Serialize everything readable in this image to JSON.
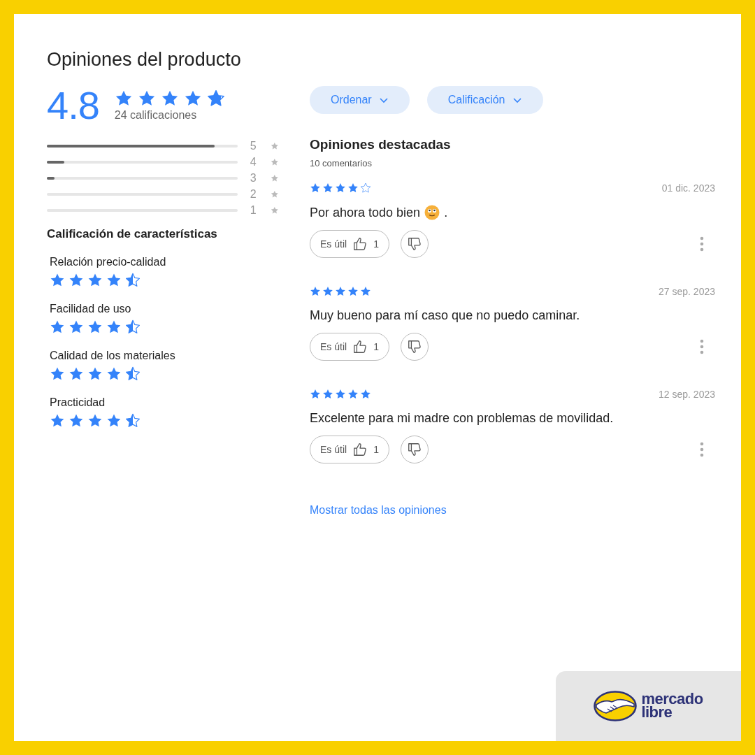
{
  "title": "Opiniones del producto",
  "summary": {
    "average": "4.8",
    "stars": 4.8,
    "count": "24 calificaciones"
  },
  "distribution": [
    {
      "label": "5",
      "level": 0.88
    },
    {
      "label": "4",
      "level": 0.09
    },
    {
      "label": "3",
      "level": 0.04
    },
    {
      "label": "2",
      "level": 0
    },
    {
      "label": "1",
      "level": 0
    }
  ],
  "features": {
    "heading": "Calificación de características",
    "items": [
      {
        "name": "Relación precio-calidad",
        "stars": 4.5
      },
      {
        "name": "Facilidad de uso",
        "stars": 4.5
      },
      {
        "name": "Calidad de los materiales",
        "stars": 4.5
      },
      {
        "name": "Practicidad",
        "stars": 4.5
      }
    ]
  },
  "filters": [
    "Ordenar",
    "Calificación"
  ],
  "reviews_section": {
    "heading": "Opiniones destacadas",
    "count": "10 comentarios"
  },
  "reviews": [
    {
      "stars": 4,
      "date": "01 dic. 2023",
      "parts": [
        {
          "kind": "text",
          "text": "Por ahora todo bien"
        },
        {
          "kind": "emoji"
        },
        {
          "kind": "text",
          "text": "."
        }
      ],
      "helpful_label": "Es útil",
      "helpful_count": "1"
    },
    {
      "stars": 5,
      "date": "27 sep. 2023",
      "parts": [
        {
          "kind": "text",
          "text": "Muy bueno para mí caso que no puedo caminar."
        }
      ],
      "helpful_label": "Es útil",
      "helpful_count": "1"
    },
    {
      "stars": 5,
      "date": "12 sep. 2023",
      "parts": [
        {
          "kind": "text",
          "text": "Excelente para mi madre con problemas de movilidad."
        }
      ],
      "helpful_label": "Es útil",
      "helpful_count": "1"
    }
  ],
  "show_all": "Mostrar todas las opiniones",
  "logo": {
    "lines": [
      "mercado",
      "libre"
    ]
  }
}
